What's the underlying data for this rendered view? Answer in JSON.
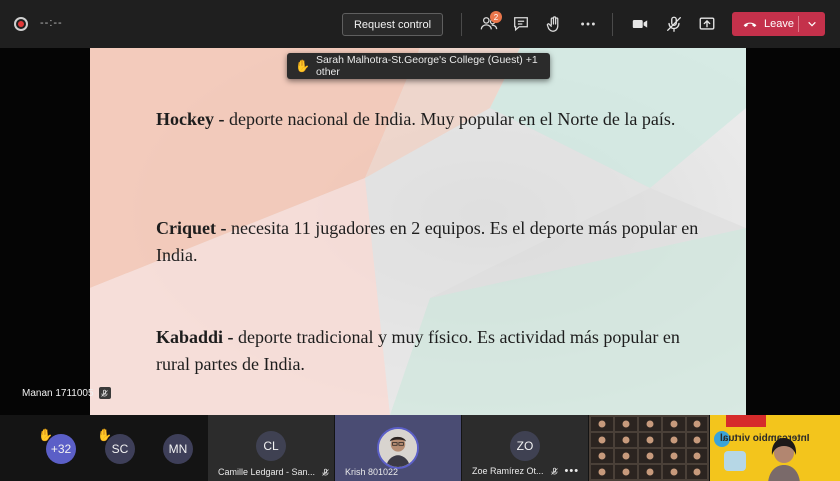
{
  "topbar": {
    "timer": "--:--",
    "request_control_label": "Request control",
    "participants_badge": "2",
    "leave_label": "Leave"
  },
  "icons": {
    "record": "record-icon",
    "participants": "people-icon",
    "chat": "chat-icon",
    "raise_hand": "hand-icon",
    "more": "more-icon",
    "camera": "camera-icon",
    "mic": "mic-off-icon",
    "share": "share-icon",
    "phone": "phone-icon"
  },
  "colors": {
    "leave": "#c4314b",
    "badge": "#e9764b",
    "avatar_purple": "#5b5fc7",
    "tile_selected": "#4a4c73"
  },
  "banner": {
    "text": "Sarah Malhotra-St.George's College (Guest) +1 other"
  },
  "presenter": {
    "name": "Manan 1711005"
  },
  "slide": {
    "paragraphs": [
      {
        "term": "Hockey -",
        "text": " deporte nacional de India. Muy popular en el Norte de la país."
      },
      {
        "term": "Criquet -",
        "text": " necesita 11 jugadores en 2 equipos. Es el deporte más popular en India."
      },
      {
        "term": "Kabaddi -",
        "text": " deporte tradicional y muy físico. Es actividad más popular en rural partes de India."
      }
    ]
  },
  "gallery": {
    "overflow_count": "+32",
    "avatars": [
      {
        "initials": "SC"
      },
      {
        "initials": "MN"
      }
    ],
    "tiles": [
      {
        "initials": "CL",
        "name": "Camille Ledgard - San..."
      },
      {
        "initials": "",
        "name": "Krish 801022"
      },
      {
        "initials": "ZO",
        "name": "Zoe Ramírez Ot..."
      }
    ],
    "banner_text": "Intercambio virtual"
  }
}
